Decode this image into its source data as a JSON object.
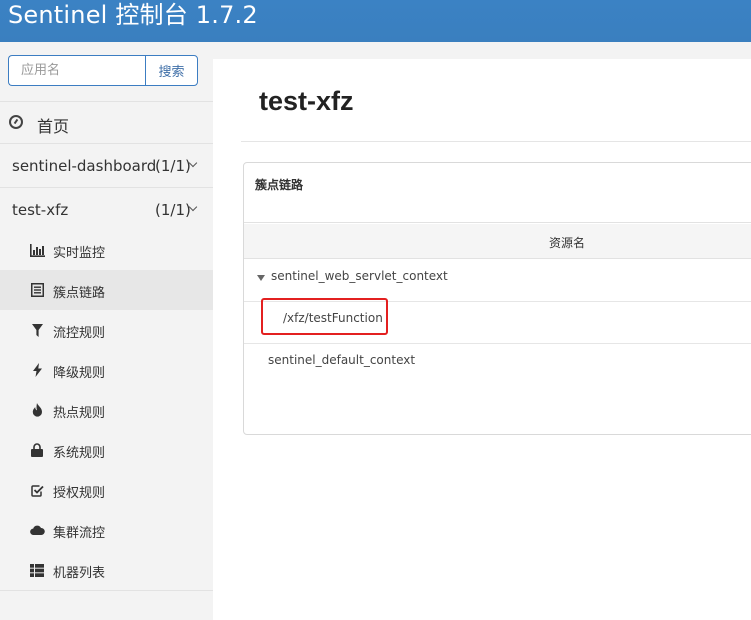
{
  "header": {
    "brand": "Sentinel 控制台 1.7.2"
  },
  "sidebar": {
    "search": {
      "placeholder": "应用名",
      "button_label": "搜索"
    },
    "home": {
      "label": "首页",
      "icon": "clock-icon"
    },
    "apps": [
      {
        "name": "sentinel-dashboard",
        "count": "(1/1)"
      },
      {
        "name": "test-xfz",
        "count": "(1/1)"
      }
    ],
    "menu": [
      {
        "label": "实时监控",
        "icon": "bar-chart-icon"
      },
      {
        "label": "簇点链路",
        "icon": "list-icon",
        "active": true
      },
      {
        "label": "流控规则",
        "icon": "filter-icon"
      },
      {
        "label": "降级规则",
        "icon": "flash-icon"
      },
      {
        "label": "热点规则",
        "icon": "fire-icon"
      },
      {
        "label": "系统规则",
        "icon": "lock-icon"
      },
      {
        "label": "授权规则",
        "icon": "check-square-icon"
      },
      {
        "label": "集群流控",
        "icon": "cloud-icon"
      },
      {
        "label": "机器列表",
        "icon": "th-list-icon"
      }
    ]
  },
  "main": {
    "title": "test-xfz",
    "panel": {
      "title": "簇点链路",
      "column_header": "资源名",
      "rows": [
        {
          "name": "sentinel_web_servlet_context",
          "expanded": true
        },
        {
          "name": "/xfz/testFunction",
          "highlighted": true
        },
        {
          "name": "sentinel_default_context"
        }
      ]
    }
  },
  "colors": {
    "navbar": "#3a7fbf",
    "highlight": "#e32020"
  }
}
